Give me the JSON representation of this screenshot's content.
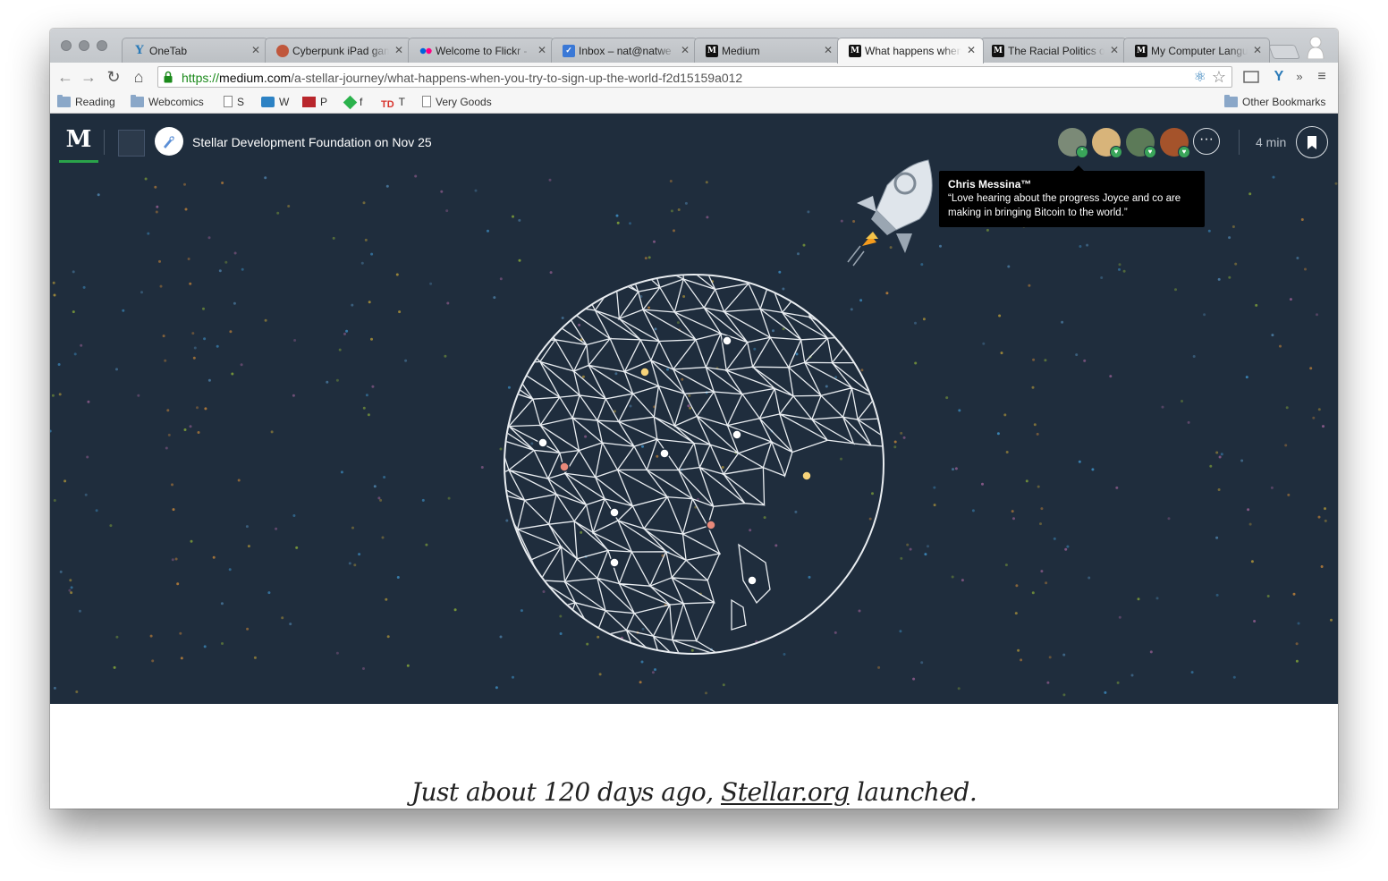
{
  "browser": {
    "tabs": [
      {
        "title": "OneTab",
        "favicon": "onetab-icon"
      },
      {
        "title": "Cyberpunk iPad game",
        "favicon": "avatar-icon"
      },
      {
        "title": "Welcome to Flickr -",
        "favicon": "flickr-icon"
      },
      {
        "title": "Inbox – nat@natwe",
        "favicon": "inbox-icon"
      },
      {
        "title": "Medium",
        "favicon": "medium-icon"
      },
      {
        "title": "What happens when",
        "favicon": "medium-icon"
      },
      {
        "title": "The Racial Politics o",
        "favicon": "medium-icon"
      },
      {
        "title": "My Computer Langu",
        "favicon": "medium-icon"
      }
    ],
    "active_tab_index": 5,
    "url": {
      "protocol": "https://",
      "host": "medium.com",
      "path": "/a-stellar-journey/what-happens-when-you-try-to-sign-up-the-world-f2d15159a012"
    },
    "bookmarks": [
      {
        "label": "Reading",
        "icon": "folder-icon"
      },
      {
        "label": "Webcomics",
        "icon": "folder-icon"
      },
      {
        "label": "S",
        "icon": "page-icon"
      },
      {
        "label": "W",
        "icon": "list-icon"
      },
      {
        "label": "P",
        "icon": "pin-icon"
      },
      {
        "label": "f",
        "icon": "feedly-icon"
      },
      {
        "label": "T",
        "icon": "todoist-icon"
      },
      {
        "label": "Very Goods",
        "icon": "page-icon"
      }
    ],
    "other_bookmarks": "Other Bookmarks"
  },
  "article": {
    "logo": "M",
    "byline": "Stellar Development Foundation on Nov 25",
    "read_time": "4 min",
    "more": "···",
    "tooltip": {
      "name": "Chris Messina™",
      "quote_line1": "“Love hearing about the progress Joyce and co are",
      "quote_line2": "making in bringing Bitcoin to the world.”"
    },
    "lead_before": "Just about 120 days ago, ",
    "lead_link": "Stellar.org",
    "lead_after": " launched."
  },
  "colors": {
    "hero_bg": "#1f2d3d",
    "accent_green": "#2aa34a",
    "node_yellow": "#f6d37a",
    "node_red": "#e8897a"
  }
}
